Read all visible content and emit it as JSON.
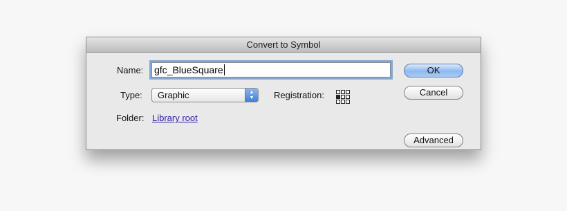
{
  "dialog": {
    "title": "Convert to Symbol",
    "name_label": "Name:",
    "name_value": "gfc_BlueSquare",
    "type_label": "Type:",
    "type_value": "Graphic",
    "registration_label": "Registration:",
    "folder_label": "Folder:",
    "folder_link": "Library root"
  },
  "buttons": {
    "ok": "OK",
    "cancel": "Cancel",
    "advanced": "Advanced"
  }
}
